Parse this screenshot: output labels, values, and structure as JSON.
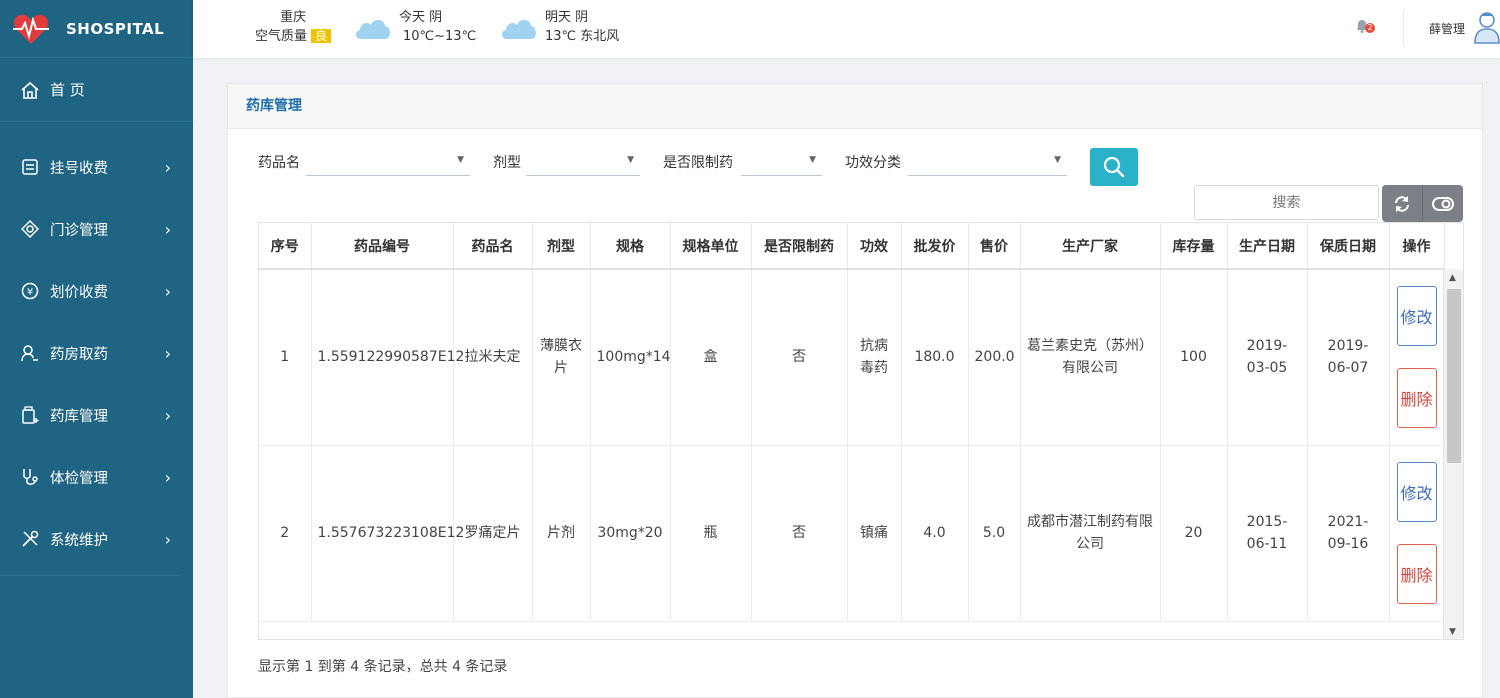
{
  "brand": {
    "name": "SHOSPITAL"
  },
  "sidebar": {
    "home_label": "首 页",
    "items": [
      {
        "label": "挂号收费",
        "icon": "register-icon"
      },
      {
        "label": "门诊管理",
        "icon": "clinic-icon"
      },
      {
        "label": "划价收费",
        "icon": "pricing-icon"
      },
      {
        "label": "药房取药",
        "icon": "pharmacy-icon"
      },
      {
        "label": "药库管理",
        "icon": "drug-store-icon"
      },
      {
        "label": "体检管理",
        "icon": "checkup-icon"
      },
      {
        "label": "系统维护",
        "icon": "tools-icon"
      }
    ]
  },
  "header": {
    "city": "重庆",
    "air_quality_label": "空气质量",
    "air_quality_value": "良",
    "today_label": "今天",
    "today_weather": "阴",
    "today_temp": "10℃~13℃",
    "tomorrow_label": "明天",
    "tomorrow_weather": "阴",
    "tomorrow_detail": "13℃ 东北风",
    "notification_count": "2",
    "username": "薛管理"
  },
  "panel": {
    "title": "药库管理",
    "filters": {
      "drug_name_label": "药品名",
      "dosage_form_label": "剂型",
      "restricted_label": "是否限制药",
      "efficacy_label": "功效分类"
    },
    "search_placeholder": "搜索"
  },
  "table": {
    "columns": [
      "序号",
      "药品编号",
      "药品名",
      "剂型",
      "规格",
      "规格单位",
      "是否限制药",
      "功效",
      "批发价",
      "售价",
      "生产厂家",
      "库存量",
      "生产日期",
      "保质日期",
      "操作"
    ],
    "rows": [
      {
        "index": "1",
        "code": "1.559122990587E12",
        "name": "拉米夫定",
        "form": "薄膜衣片",
        "spec": "100mg*14",
        "unit": "盒",
        "restricted": "否",
        "efficacy": "抗病毒药",
        "wholesale": "180.0",
        "price": "200.0",
        "maker": "葛兰素史克（苏州）有限公司",
        "stock": "100",
        "produced": "2019-03-05",
        "expires": "2019-06-07",
        "edit": "修改",
        "delete": "删除"
      },
      {
        "index": "2",
        "code": "1.557673223108E12",
        "name": "罗痛定片",
        "form": "片剂",
        "spec": "30mg*20",
        "unit": "瓶",
        "restricted": "否",
        "efficacy": "镇痛",
        "wholesale": "4.0",
        "price": "5.0",
        "maker": "成都市潜江制药有限公司",
        "stock": "20",
        "produced": "2015-06-11",
        "expires": "2021-09-16",
        "edit": "修改",
        "delete": "删除"
      }
    ]
  },
  "pagination": {
    "info": "显示第 1 到第 4 条记录，总共 4 条记录"
  },
  "colors": {
    "sidebar": "#1f6482",
    "accent": "#2ab2c8",
    "edit": "#3e6cb8",
    "delete": "#d9453a",
    "badge": "#f2c400"
  }
}
